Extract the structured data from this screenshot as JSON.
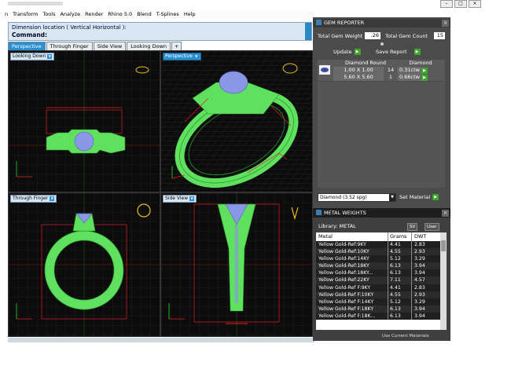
{
  "menu": [
    "n",
    "Transform",
    "Tools",
    "Analyze",
    "Render",
    "Rhino 5.0",
    "Blend",
    "T-Splines",
    "Help"
  ],
  "window_buttons": [
    "–",
    "□",
    "×"
  ],
  "command": {
    "line1": "Dimension location ( Vertical  Horizontal ):",
    "prompt": "Command:"
  },
  "viewport_tabs": [
    "Perspective",
    "Through Finger",
    "Side View",
    "Looking Down",
    "+"
  ],
  "viewports": {
    "top_left": "Looking Down",
    "top_right": "Perspective",
    "bottom_left": "Through Finger",
    "bottom_right": "Side View"
  },
  "gem_reporter": {
    "title": "GEM REPORTER",
    "total_weight_label": "Total Gem Weight",
    "total_weight_value": ".26",
    "total_count_label": "Total Gem Count",
    "total_count_value": "15",
    "update_label": "Update",
    "save_report_label": "Save Report",
    "headers": [
      "Diamond Round",
      "Diamond"
    ],
    "rows": [
      {
        "size": "1.00 X 1.00",
        "count": "14",
        "ctw": "0.31ctw"
      },
      {
        "size": "5.60 X 5.60",
        "count": "1",
        "ctw": "0.66ctw"
      }
    ],
    "material_select": "Diamond    (3.52 spg)",
    "set_material_label": "Set Material"
  },
  "metal_weights": {
    "title": "METAL WEIGHTS",
    "library_label": "Library: METAL",
    "btn_sv": "SV",
    "btn_user": "User",
    "columns": [
      "Metal",
      "Grams",
      "DWT"
    ],
    "rows": [
      [
        "Yellow Gold-Ref:9KY",
        "4.41",
        "2.83"
      ],
      [
        "Yellow Gold-Ref:10KY",
        "4.55",
        "2.93"
      ],
      [
        "Yellow Gold-Ref:14KY",
        "5.12",
        "3.29"
      ],
      [
        "Yellow Gold-Ref:18KY",
        "6.13",
        "3.94"
      ],
      [
        "Yellow Gold-Ref:18KY...",
        "6.13",
        "3.94"
      ],
      [
        "Yellow Gold-Ref:22KY",
        "7.11",
        "4.57"
      ],
      [
        "Yellow Gold-Ref F:9KY",
        "4.41",
        "2.83"
      ],
      [
        "Yellow Gold-Ref F:10KY",
        "4.55",
        "2.93"
      ],
      [
        "Yellow Gold-Ref F:14KY",
        "5.12",
        "3.29"
      ],
      [
        "Yellow Gold-Ref F:18KY",
        "6.13",
        "3.94"
      ],
      [
        "Yellow Gold-Ref F:18K...",
        "6.13",
        "3.94"
      ]
    ],
    "footer": "Use Current Materials"
  },
  "colors": {
    "model_green": "#5fe05f",
    "gem_blue": "#8a96e6",
    "dim_red": "#e02020",
    "accent_blue": "#2b8fd0"
  }
}
